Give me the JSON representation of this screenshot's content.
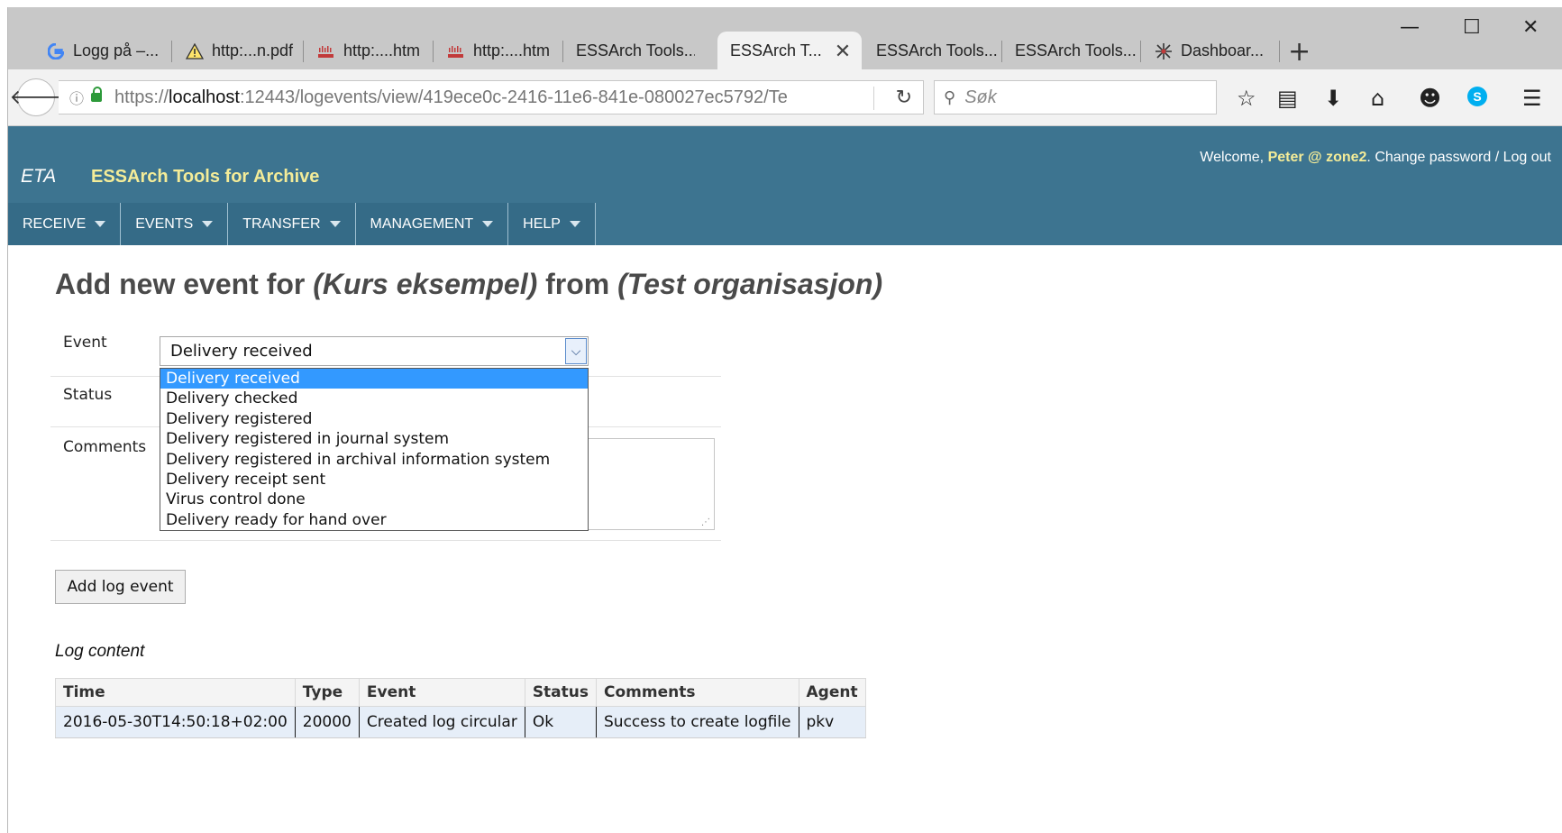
{
  "browser": {
    "tabs": [
      {
        "label": "Logg på –...",
        "icon": "google-icon"
      },
      {
        "label": "http:...n.pdf",
        "icon": "warning-icon"
      },
      {
        "label": "http:....htm",
        "icon": "cisco-icon"
      },
      {
        "label": "http:....htm",
        "icon": "cisco-icon"
      },
      {
        "label": "ESSArch Tools..."
      },
      {
        "label": "ESSArch T...",
        "active": true
      },
      {
        "label": "ESSArch Tools..."
      },
      {
        "label": "ESSArch Tools..."
      },
      {
        "label": "Dashboar...",
        "icon": "spark-icon"
      }
    ],
    "url_prefix": "https://",
    "url_host": "localhost",
    "url_rest": ":12443/logevents/view/419ece0c-2416-11e6-841e-080027ec5792/Te",
    "search_placeholder": "Søk"
  },
  "app": {
    "short": "ETA",
    "title": "ESSArch Tools for Archive",
    "welcome_prefix": "Welcome, ",
    "user": "Peter @ zone2",
    "welcome_suffix": ". Change password / Log out",
    "menu": [
      "RECEIVE",
      "EVENTS",
      "TRANSFER",
      "MANAGEMENT",
      "HELP"
    ]
  },
  "page": {
    "title_prefix": "Add new event for ",
    "title_archive": "(Kurs eksempel)",
    "title_mid": " from ",
    "title_org": "(Test organisasjon)"
  },
  "form": {
    "event_label": "Event",
    "status_label": "Status",
    "comments_label": "Comments",
    "event_selected": "Delivery received",
    "event_options": [
      "Delivery received",
      "Delivery checked",
      "Delivery registered",
      "Delivery registered in journal system",
      "Delivery registered in archival information system",
      "Delivery receipt sent",
      "Virus control done",
      "Delivery ready for hand over"
    ],
    "submit_label": "Add log event"
  },
  "log": {
    "caption": "Log content",
    "headers": [
      "Time",
      "Type",
      "Event",
      "Status",
      "Comments",
      "Agent"
    ],
    "rows": [
      [
        "2016-05-30T14:50:18+02:00",
        "20000",
        "Created log circular",
        "Ok",
        "Success to create logfile",
        "pkv"
      ]
    ]
  }
}
